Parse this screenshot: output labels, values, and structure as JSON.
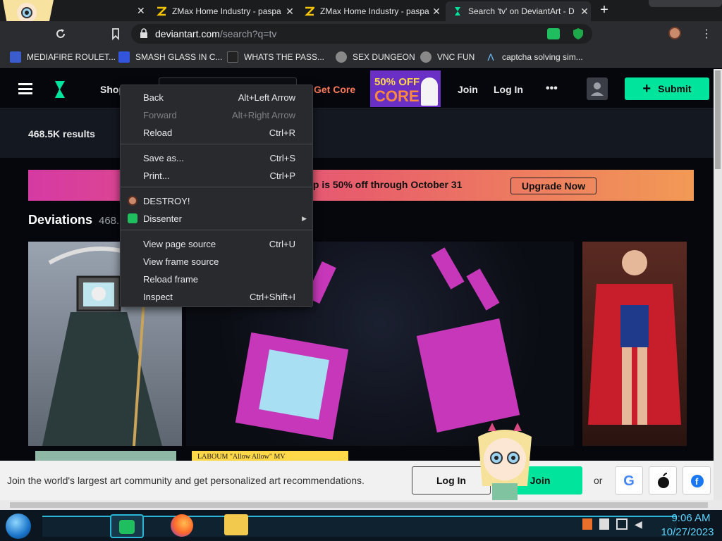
{
  "browser": {
    "tabs": [
      {
        "title": "ZMax Home Industry - paspa",
        "icon": "zmax-favicon"
      },
      {
        "title": "ZMax Home Industry - paspa",
        "icon": "zmax-favicon"
      },
      {
        "title": "Search 'tv' on DeviantArt - D",
        "icon": "deviantart-favicon",
        "active": true
      }
    ],
    "new_tab_symbol": "+",
    "close_symbol": "✕",
    "address": {
      "domain": "deviantart.com",
      "path": "/search?q=tv"
    },
    "bookmarks": [
      {
        "label": "MEDIAFIRE ROULET...",
        "icon": "mediafire-icon",
        "color": "#3a5ccc"
      },
      {
        "label": "SMASH GLASS IN C...",
        "icon": "zmax-icon",
        "color": "#3355dd"
      },
      {
        "label": "WHATS THE PASS...",
        "icon": "ghost-icon",
        "color": "#222222"
      },
      {
        "label": "SEX DUNGEON",
        "icon": "spider-icon",
        "color": "#888888"
      },
      {
        "label": "VNC FUN",
        "icon": "spider-icon",
        "color": "#888888"
      },
      {
        "label": "captcha solving sim...",
        "icon": "lambda-icon",
        "color": "#6ac0ff"
      }
    ]
  },
  "site": {
    "nav": {
      "shop": "Shop",
      "get_core": "Get Core",
      "join": "Join",
      "login": "Log In",
      "more": "•••",
      "submit": "Submit"
    },
    "core_badge": {
      "line1": "50% OFF",
      "line2": "CORE"
    },
    "results_count": "468.5K results",
    "promo": {
      "text": "ip is 50% off through October 31",
      "button": "Upgrade Now"
    },
    "deviations": {
      "title": "Deviations",
      "count": "468."
    },
    "thumb_caption": "LABOUM \"Allow Allow\" MV"
  },
  "context_menu": {
    "items": [
      {
        "label": "Back",
        "shortcut": "Alt+Left Arrow",
        "disabled": false
      },
      {
        "label": "Forward",
        "shortcut": "Alt+Right Arrow",
        "disabled": true
      },
      {
        "label": "Reload",
        "shortcut": "Ctrl+R",
        "disabled": false
      },
      {
        "label": "Save as...",
        "shortcut": "Ctrl+S",
        "disabled": false
      },
      {
        "label": "Print...",
        "shortcut": "Ctrl+P",
        "disabled": false
      },
      {
        "label": "DESTROY!",
        "shortcut": "",
        "icon": "avatar-icon"
      },
      {
        "label": "Dissenter",
        "shortcut": "",
        "icon": "dissenter-icon",
        "submenu": true
      },
      {
        "label": "View page source",
        "shortcut": "Ctrl+U",
        "disabled": false
      },
      {
        "label": "View frame source",
        "shortcut": "",
        "disabled": false
      },
      {
        "label": "Reload frame",
        "shortcut": "",
        "disabled": false
      },
      {
        "label": "Inspect",
        "shortcut": "Ctrl+Shift+I",
        "disabled": false
      }
    ]
  },
  "cookie_bar": {
    "text": "Join the world's largest art community and get personalized art recommendations.",
    "login": "Log In",
    "join": "Join",
    "or": "or"
  },
  "taskbar": {
    "time": "9:06 AM",
    "date": "10/27/2023"
  },
  "colors": {
    "accent_green": "#00e59b",
    "core_orange": "#ff7b5b",
    "dissenter_green": "#1fbf5f"
  }
}
